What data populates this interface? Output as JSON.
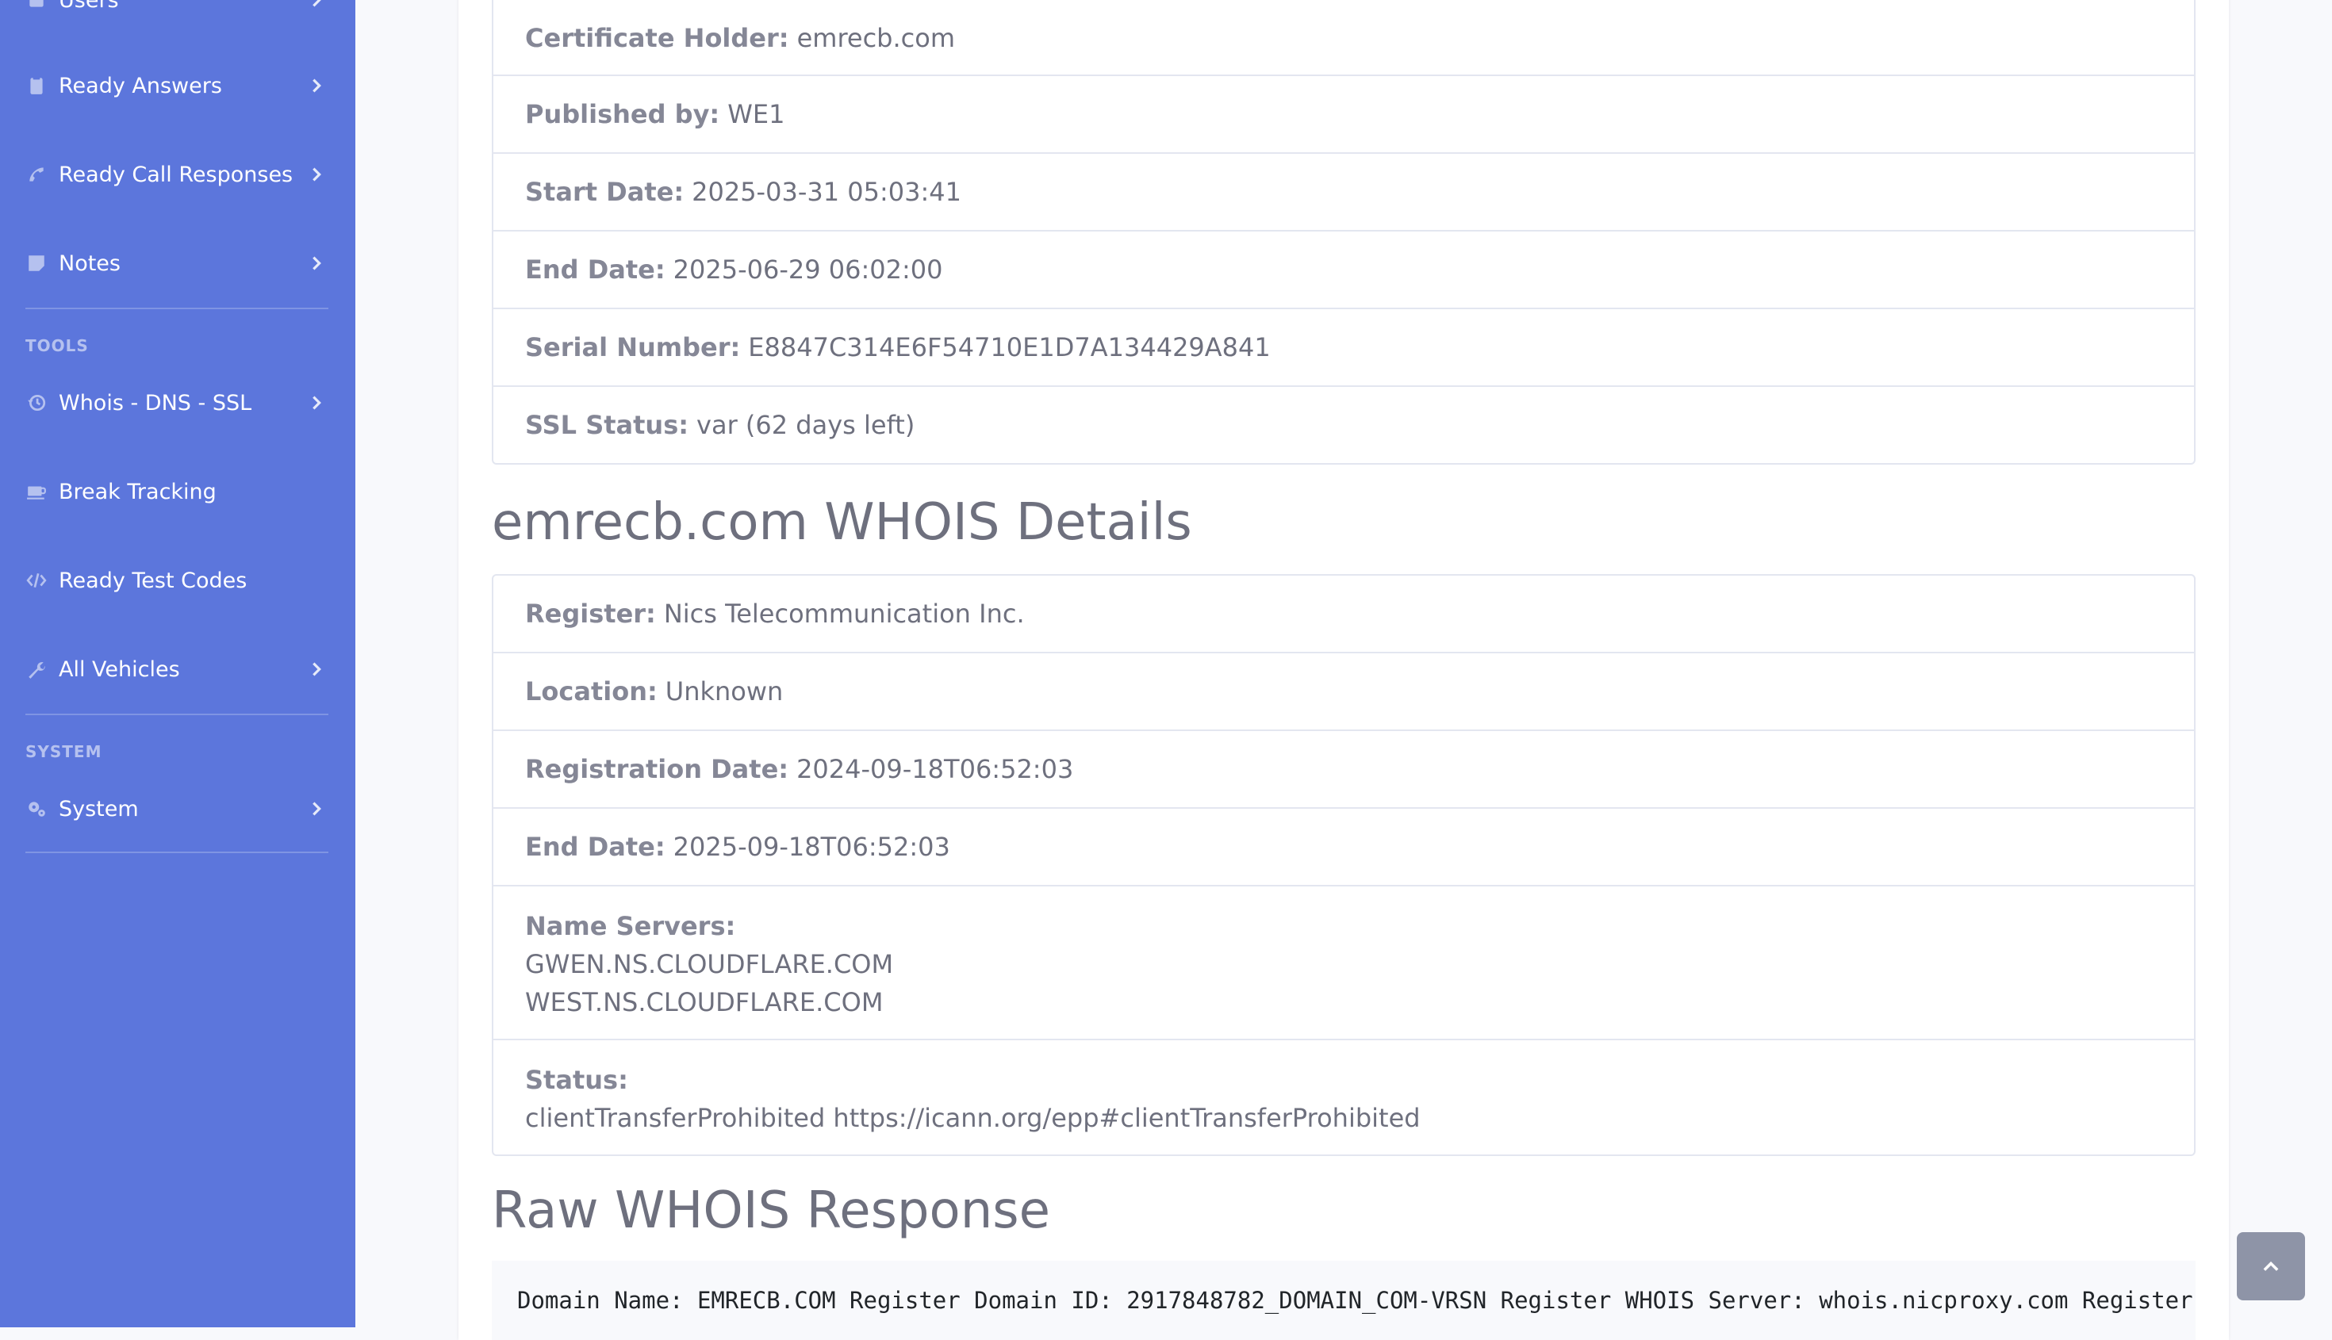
{
  "sidebar": {
    "items": [
      {
        "label": "Users",
        "icon": "users-icon"
      },
      {
        "label": "Ready Answers",
        "icon": "clipboard-icon"
      },
      {
        "label": "Ready Call Responses",
        "icon": "phone-icon"
      },
      {
        "label": "Notes",
        "icon": "note-icon"
      },
      {
        "label": "Whois - DNS - SSL",
        "icon": "history-icon"
      },
      {
        "label": "Break Tracking",
        "icon": "coffee-icon"
      },
      {
        "label": "Ready Test Codes",
        "icon": "code-icon"
      },
      {
        "label": "All Vehicles",
        "icon": "wrench-icon"
      },
      {
        "label": "System",
        "icon": "cogs-icon"
      }
    ],
    "headings": {
      "tools": "TOOLS",
      "system": "SYSTEM"
    }
  },
  "ssl": {
    "certificate_holder": {
      "label": "Certificate Holder:",
      "value": "emrecb.com"
    },
    "published_by": {
      "label": "Published by:",
      "value": "WE1"
    },
    "start_date": {
      "label": "Start Date:",
      "value": "2025-03-31 05:03:41"
    },
    "end_date": {
      "label": "End Date:",
      "value": "2025-06-29 06:02:00"
    },
    "serial_number": {
      "label": "Serial Number:",
      "value": "E8847C314E6F54710E1D7A134429A841"
    },
    "ssl_status": {
      "label": "SSL Status:",
      "value": "var (62 days left)"
    }
  },
  "whois": {
    "title": "emrecb.com WHOIS Details",
    "register": {
      "label": "Register:",
      "value": "Nics Telecommunication Inc."
    },
    "location": {
      "label": "Location:",
      "value": "Unknown"
    },
    "registration_date": {
      "label": "Registration Date:",
      "value": "2024-09-18T06:52:03"
    },
    "end_date": {
      "label": "End Date:",
      "value": "2025-09-18T06:52:03"
    },
    "name_servers": {
      "label": "Name Servers:",
      "values": [
        "GWEN.NS.CLOUDFLARE.COM",
        "WEST.NS.CLOUDFLARE.COM"
      ]
    },
    "status": {
      "label": "Status:",
      "value": "clientTransferProhibited https://icann.org/epp#clientTransferProhibited"
    }
  },
  "raw": {
    "title": "Raw WHOIS Response",
    "text": "Domain Name: EMRECB.COM Register Domain ID: 2917848782_DOMAIN_COM-VRSN Register WHOIS Server: whois.nicproxy.com Register URL: http://www.nicproxy.com"
  },
  "colors": {
    "sidebar": "#5c76dc",
    "background": "#f8f9fc",
    "text": "#858796"
  }
}
